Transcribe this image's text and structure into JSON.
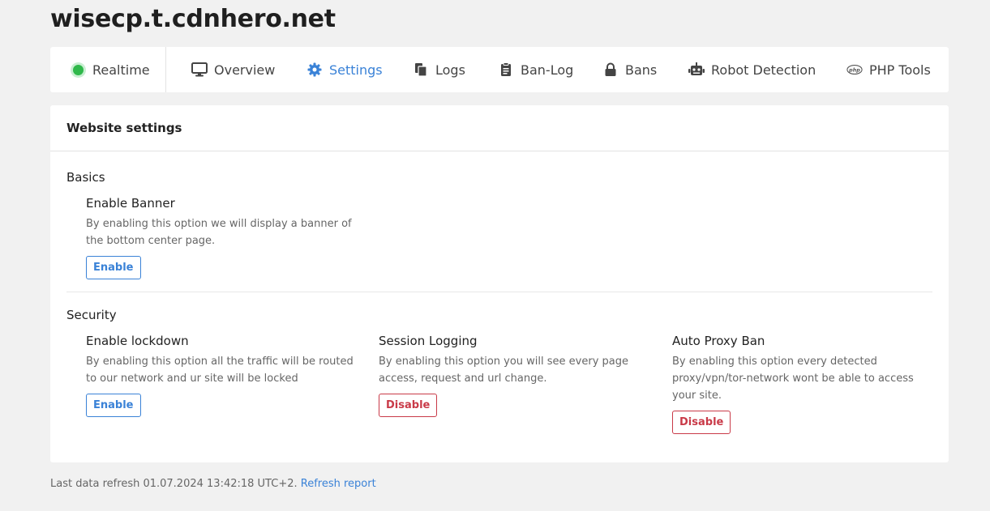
{
  "site": {
    "title": "wisecp.t.cdnhero.net"
  },
  "nav": {
    "realtime": "Realtime",
    "overview": "Overview",
    "settings": "Settings",
    "logs": "Logs",
    "banlog": "Ban-Log",
    "bans": "Bans",
    "robot": "Robot Detection",
    "php": "PHP Tools",
    "active": "Settings",
    "colors": {
      "active": "#3a82d7",
      "realtime_dot": "#2fb84a"
    }
  },
  "settings": {
    "header": "Website settings",
    "basics": {
      "title": "Basics",
      "banner": {
        "title": "Enable Banner",
        "desc": "By enabling this option we will display a banner of the bottom center page.",
        "button": "Enable"
      }
    },
    "security": {
      "title": "Security",
      "lockdown": {
        "title": "Enable lockdown",
        "desc": "By enabling this option all the traffic will be routed to our network and ur site will be locked",
        "button": "Enable"
      },
      "session": {
        "title": "Session Logging",
        "desc": "By enabling this option you will see every page access, request and url change.",
        "button": "Disable"
      },
      "proxy": {
        "title": "Auto Proxy Ban",
        "desc": "By enabling this option every detected proxy/vpn/tor-network wont be able to access your site.",
        "button": "Disable"
      }
    },
    "colors": {
      "enable": "#3a82d7",
      "disable": "#c93a48"
    }
  },
  "footer": {
    "text": "Last data refresh 01.07.2024 13:42:18 UTC+2.",
    "link": "Refresh report"
  }
}
